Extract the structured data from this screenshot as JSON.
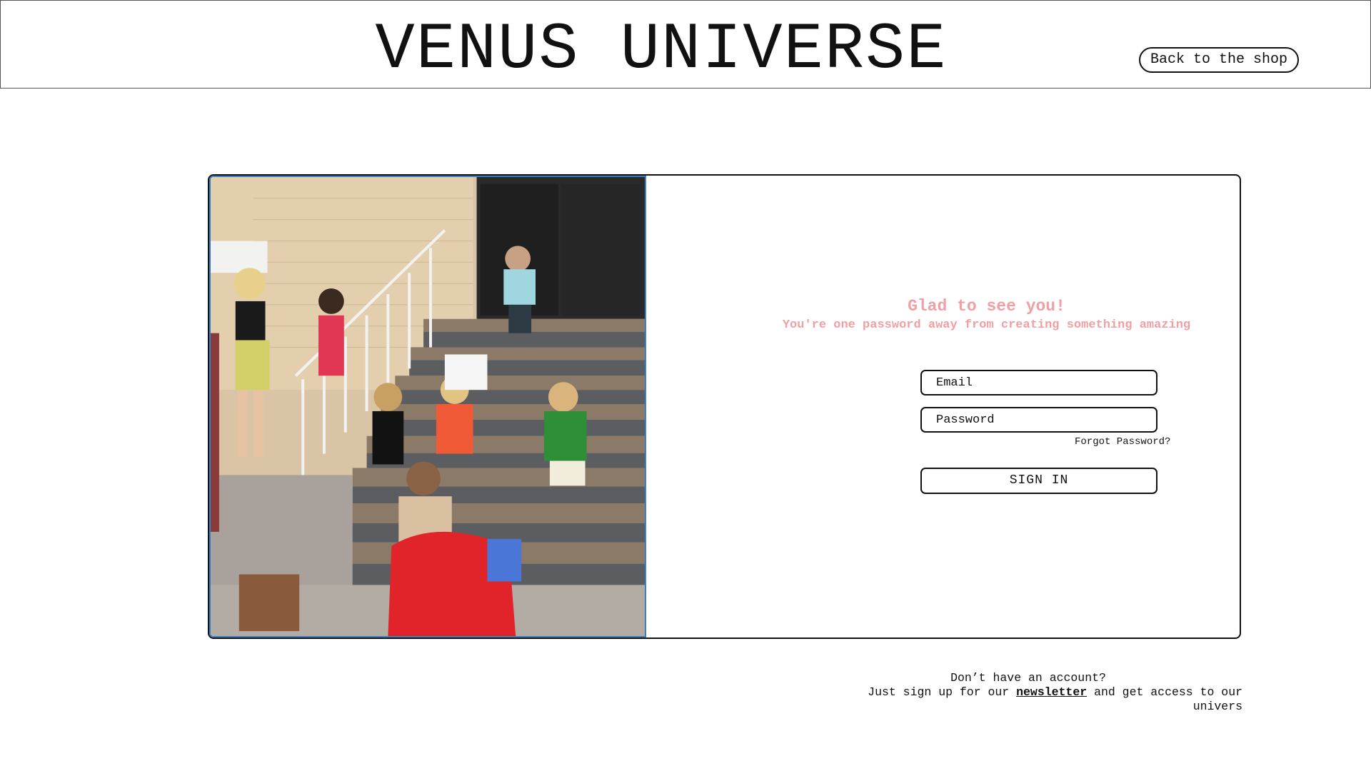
{
  "header": {
    "brand": "VENUS UNIVERSE",
    "back_label": "Back to the shop"
  },
  "hero_image": {
    "alt": "Group of young women sitting on outdoor stairs"
  },
  "login": {
    "title": "Glad to see you!",
    "subtitle": "You're one password away from creating something amazing",
    "email_placeholder": "Email",
    "password_placeholder": "Password",
    "forgot_label": "Forgot Password?",
    "signin_label": "SIGN IN"
  },
  "signup": {
    "question": "Don’t have an account?",
    "prefix": "Just sign up for our",
    "link_label": "newsletter",
    "suffix": "and get access to our univers"
  },
  "colors": {
    "accent_pink": "#f0a0a4",
    "image_border": "#3a82c4",
    "outline": "#111111"
  }
}
